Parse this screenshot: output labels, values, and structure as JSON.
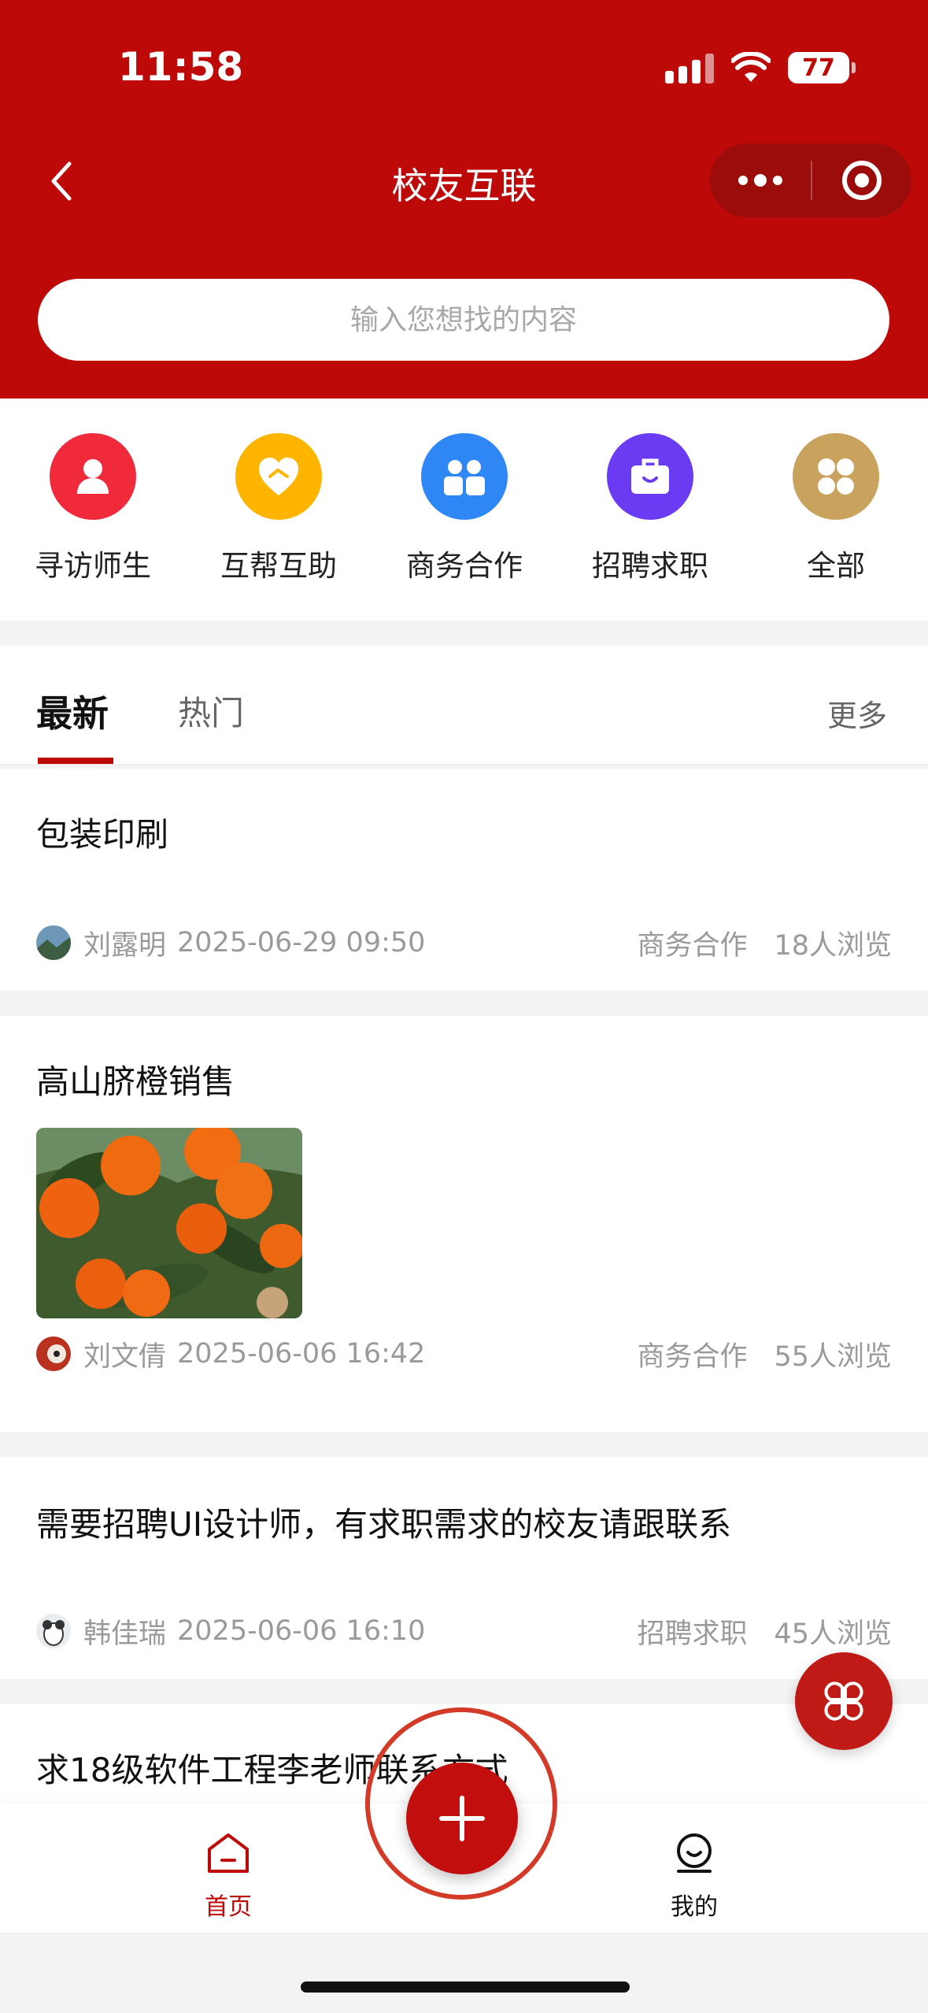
{
  "status_bar": {
    "time": "11:58",
    "battery": "77"
  },
  "nav": {
    "title": "校友互联"
  },
  "search": {
    "placeholder": "输入您想找的内容"
  },
  "categories": [
    {
      "label": "寻访师生",
      "icon": "person-icon",
      "color": "#f02a3a"
    },
    {
      "label": "互帮互助",
      "icon": "heart-hand-icon",
      "color": "#ffb400"
    },
    {
      "label": "商务合作",
      "icon": "partners-icon",
      "color": "#2f86f5"
    },
    {
      "label": "招聘求职",
      "icon": "briefcase-icon",
      "color": "#6a3bf2"
    },
    {
      "label": "全部",
      "icon": "grid-icon",
      "color": "#c9a25e"
    }
  ],
  "tabs": {
    "latest": "最新",
    "hot": "热门",
    "more": "更多"
  },
  "posts": [
    {
      "title": "包装印刷",
      "author": "刘露明",
      "time": "2025-06-29 09:50",
      "category": "商务合作",
      "views": "18人浏览"
    },
    {
      "title": "高山脐橙销售",
      "author": "刘文倩",
      "time": "2025-06-06 16:42",
      "category": "商务合作",
      "views": "55人浏览"
    },
    {
      "title": "需要招聘UI设计师，有求职需求的校友请跟联系",
      "author": "韩佳瑞",
      "time": "2025-06-06 16:10",
      "category": "招聘求职",
      "views": "45人浏览"
    },
    {
      "title": "求18级软件工程李老师联系方式"
    }
  ],
  "bottom_nav": {
    "home": "首页",
    "mine": "我的"
  },
  "colors": {
    "brand_red": "#bd0a09",
    "text_gray": "#9a9a9a"
  }
}
